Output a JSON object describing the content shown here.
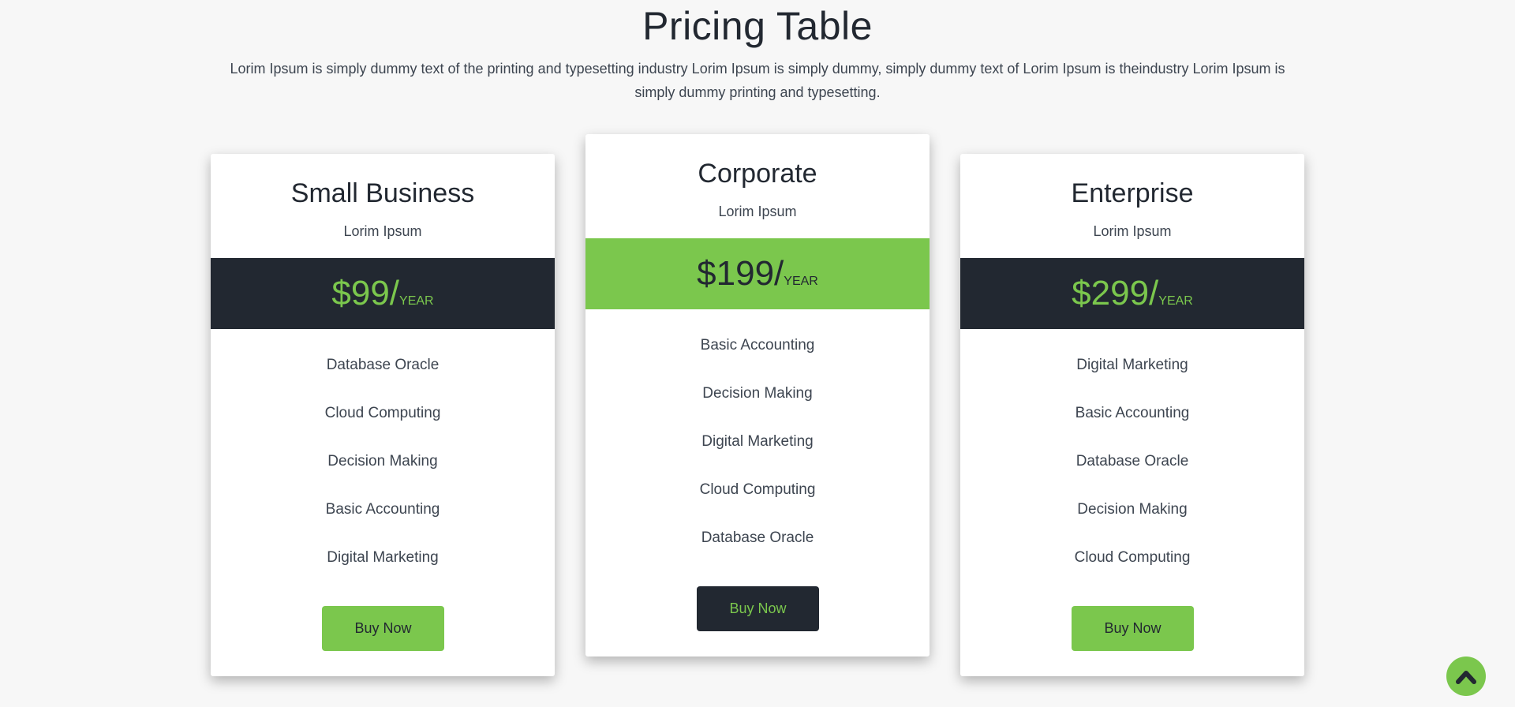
{
  "header": {
    "title": "Pricing Table",
    "description": "Lorim Ipsum is simply dummy text of the printing and typesetting industry Lorim Ipsum is simply dummy, simply dummy text of Lorim Ipsum is theindustry Lorim Ipsum is simply dummy printing and typesetting."
  },
  "plans": [
    {
      "name": "Small Business",
      "subtitle": "Lorim Ipsum",
      "price": "$99/",
      "unit": "YEAR",
      "features": [
        "Database Oracle",
        "Cloud Computing",
        "Decision Making",
        "Basic Accounting",
        "Digital Marketing"
      ],
      "button_label": "Buy Now"
    },
    {
      "name": "Corporate",
      "subtitle": "Lorim Ipsum",
      "price": "$199/",
      "unit": "YEAR",
      "features": [
        "Basic Accounting",
        "Decision Making",
        "Digital Marketing",
        "Cloud Computing",
        "Database Oracle"
      ],
      "button_label": "Buy Now"
    },
    {
      "name": "Enterprise",
      "subtitle": "Lorim Ipsum",
      "price": "$299/",
      "unit": "YEAR",
      "features": [
        "Digital Marketing",
        "Basic Accounting",
        "Database Oracle",
        "Decision Making",
        "Cloud Computing"
      ],
      "button_label": "Buy Now"
    }
  ],
  "colors": {
    "accent": "#7bc74d",
    "dark": "#222831",
    "background": "#f7f7f7"
  },
  "scroll_top": {
    "icon": "chevron-up-icon"
  }
}
